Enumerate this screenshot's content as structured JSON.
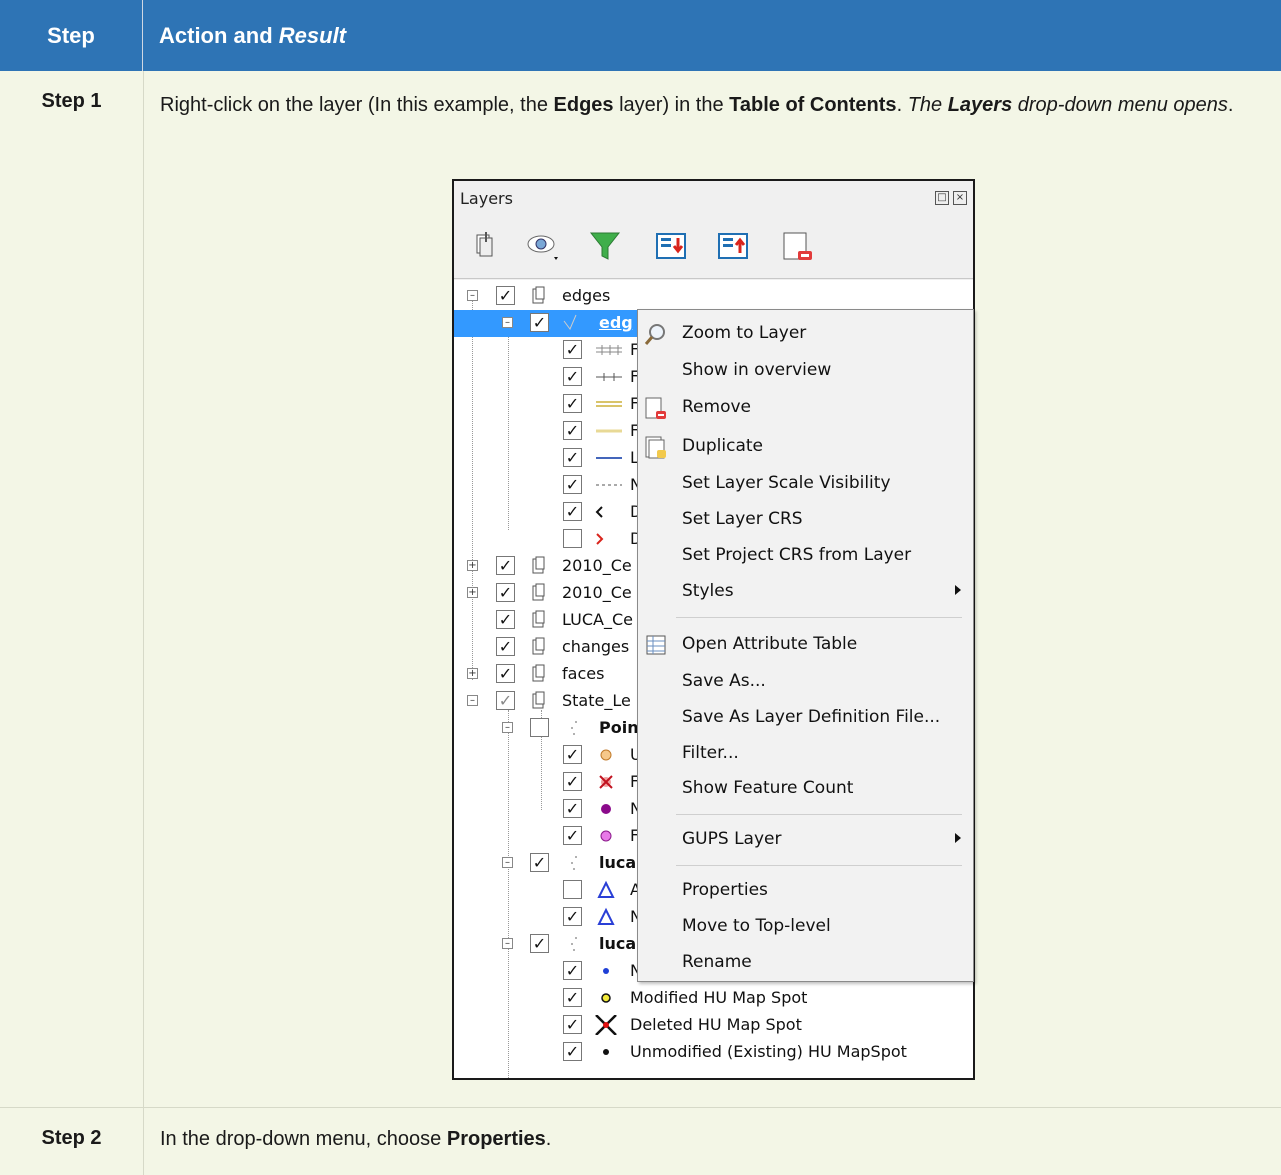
{
  "header": {
    "step": "Step",
    "action": "Action and ",
    "result": "Result"
  },
  "step1": {
    "label": "Step 1",
    "t1": "Right-click on the layer (In this example, the ",
    "b1": "Edges",
    "t2": " layer) in the ",
    "b2": "Table of Contents",
    "t3": ". ",
    "i1": "The ",
    "bi1": "Layers",
    "i2": " drop-down menu opens",
    "t4": "."
  },
  "step2": {
    "label": "Step 2",
    "t1": "In the drop-down menu, choose ",
    "b1": "Properties",
    "t2": "."
  },
  "panel": {
    "title": "Layers",
    "toolbar_icons": [
      "add-group-icon",
      "eye-icon",
      "filter-icon",
      "expand-all-icon",
      "collapse-all-icon",
      "remove-layer-icon"
    ],
    "tree": [
      {
        "label": "edges"
      },
      {
        "label": "edg"
      },
      {
        "label": "F"
      },
      {
        "label": "F"
      },
      {
        "label": "F"
      },
      {
        "label": "F"
      },
      {
        "label": "L"
      },
      {
        "label": "N"
      },
      {
        "label": "D"
      },
      {
        "label": "D"
      },
      {
        "label": "2010_Ce"
      },
      {
        "label": "2010_Ce"
      },
      {
        "label": "LUCA_Ce"
      },
      {
        "label": "changes"
      },
      {
        "label": "faces"
      },
      {
        "label": "State_Le"
      },
      {
        "label": "Poin"
      },
      {
        "label": "U"
      },
      {
        "label": "F"
      },
      {
        "label": "N"
      },
      {
        "label": "F"
      },
      {
        "label": "luca"
      },
      {
        "label": "A"
      },
      {
        "label": "N"
      },
      {
        "label": "luca"
      },
      {
        "label": "N"
      },
      {
        "label": "Modified HU Map Spot"
      },
      {
        "label": "Deleted HU Map Spot"
      },
      {
        "label": "Unmodified (Existing) HU MapSpot"
      }
    ]
  },
  "menu": {
    "items": [
      {
        "label": "Zoom to Layer",
        "icon": "zoom-icon"
      },
      {
        "label": "Show in overview"
      },
      {
        "label": "Remove",
        "icon": "remove-icon"
      },
      {
        "label": "Duplicate",
        "icon": "duplicate-icon"
      },
      {
        "label": "Set Layer Scale Visibility"
      },
      {
        "label": "Set Layer CRS"
      },
      {
        "label": "Set Project CRS from Layer"
      },
      {
        "label": "Styles",
        "submenu": true
      },
      {
        "label": "Open Attribute Table",
        "icon": "table-icon"
      },
      {
        "label": "Save As..."
      },
      {
        "label": "Save As Layer Definition File..."
      },
      {
        "label": "Filter..."
      },
      {
        "label": "Show Feature Count"
      },
      {
        "label": "GUPS Layer",
        "submenu": true
      },
      {
        "label": "Properties"
      },
      {
        "label": "Move to Top-level"
      },
      {
        "label": "Rename"
      }
    ]
  }
}
